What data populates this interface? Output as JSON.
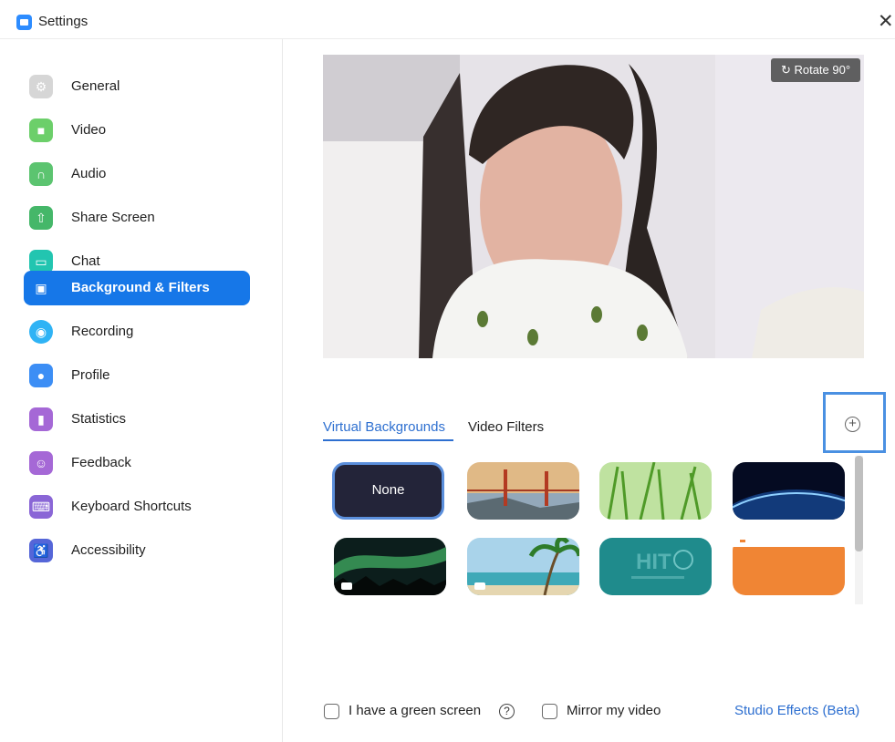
{
  "window": {
    "title": "Settings"
  },
  "sidebar": {
    "items": [
      {
        "label": "General",
        "icon": "gear-icon",
        "color": "#d6d6d6"
      },
      {
        "label": "Video",
        "icon": "camera-icon",
        "color": "#6ccf6a"
      },
      {
        "label": "Audio",
        "icon": "headphones-icon",
        "color": "#5cc470"
      },
      {
        "label": "Share Screen",
        "icon": "share-screen-icon",
        "color": "#45b769"
      },
      {
        "label": "Chat",
        "icon": "chat-icon",
        "color": "#22c5b0"
      },
      {
        "label": "Background & Filters",
        "icon": "background-icon",
        "color": "#1677e8"
      },
      {
        "label": "Recording",
        "icon": "record-icon",
        "color": "#2fb3f5"
      },
      {
        "label": "Profile",
        "icon": "profile-icon",
        "color": "#3c8ef5"
      },
      {
        "label": "Statistics",
        "icon": "statistics-icon",
        "color": "#a568d6"
      },
      {
        "label": "Feedback",
        "icon": "feedback-icon",
        "color": "#a568d6"
      },
      {
        "label": "Keyboard Shortcuts",
        "icon": "keyboard-icon",
        "color": "#8a66d6"
      },
      {
        "label": "Accessibility",
        "icon": "accessibility-icon",
        "color": "#5566d8"
      }
    ],
    "active_index": 5
  },
  "preview": {
    "rotate_label": "Rotate 90°"
  },
  "tabs": [
    {
      "label": "Virtual Backgrounds",
      "active": true
    },
    {
      "label": "Video Filters",
      "active": false
    }
  ],
  "backgrounds": [
    {
      "label": "None",
      "type": "none",
      "selected": true
    },
    {
      "label": "",
      "type": "golden-gate-image"
    },
    {
      "label": "",
      "type": "grass-image"
    },
    {
      "label": "",
      "type": "earth-from-space-image"
    },
    {
      "label": "",
      "type": "aurora-video"
    },
    {
      "label": "",
      "type": "beach-palm-video"
    },
    {
      "label": "",
      "type": "hit-logo-image"
    },
    {
      "label": "",
      "type": "orange-image"
    }
  ],
  "options": {
    "green_screen_label": "I have a green screen",
    "mirror_label": "Mirror my video",
    "studio_effects_label": "Studio Effects (Beta)",
    "green_screen_checked": false,
    "mirror_checked": false
  }
}
